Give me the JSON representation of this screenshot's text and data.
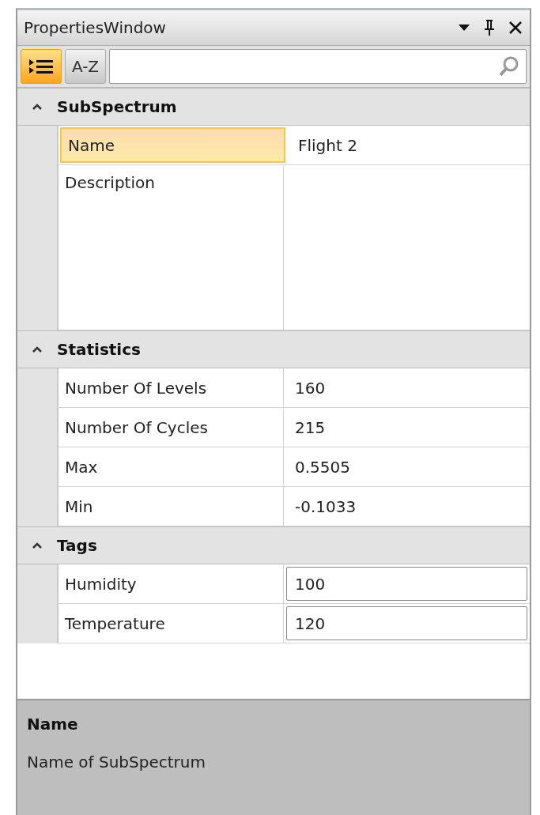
{
  "window": {
    "title": "PropertiesWindow"
  },
  "toolbar": {
    "buttons": [
      {
        "kind": "categorized",
        "selected": true
      },
      {
        "kind": "alphabetical",
        "label": "A-Z",
        "selected": false
      }
    ]
  },
  "categories": [
    {
      "name": "SubSpectrum",
      "expanded": true,
      "properties": [
        {
          "name": "Name",
          "value": "Flight 2",
          "kind": "text",
          "selected": true,
          "tall": false
        },
        {
          "name": "Description",
          "kind": "text",
          "selected": false,
          "tall": true
        }
      ]
    },
    {
      "name": "Statistics",
      "expanded": true,
      "properties": [
        {
          "name": "Number Of Levels",
          "value": "160",
          "kind": "text",
          "selected": false,
          "tall": false
        },
        {
          "name": "Number Of Cycles",
          "value": "215",
          "kind": "text",
          "selected": false,
          "tall": false
        },
        {
          "name": "Max",
          "value": "0.5505",
          "kind": "text",
          "selected": false,
          "tall": false
        },
        {
          "name": "Min",
          "value": "-0.1033",
          "kind": "text",
          "selected": false,
          "tall": false
        }
      ]
    },
    {
      "name": "Tags",
      "expanded": true,
      "properties": [
        {
          "name": "Humidity",
          "value": "100",
          "kind": "editor",
          "selected": false,
          "tall": false
        },
        {
          "name": "Temperature",
          "value": "120",
          "kind": "editor",
          "selected": false,
          "tall": false
        }
      ]
    }
  ],
  "description_panel": {
    "title": "Name",
    "text": "Name of SubSpectrum"
  }
}
